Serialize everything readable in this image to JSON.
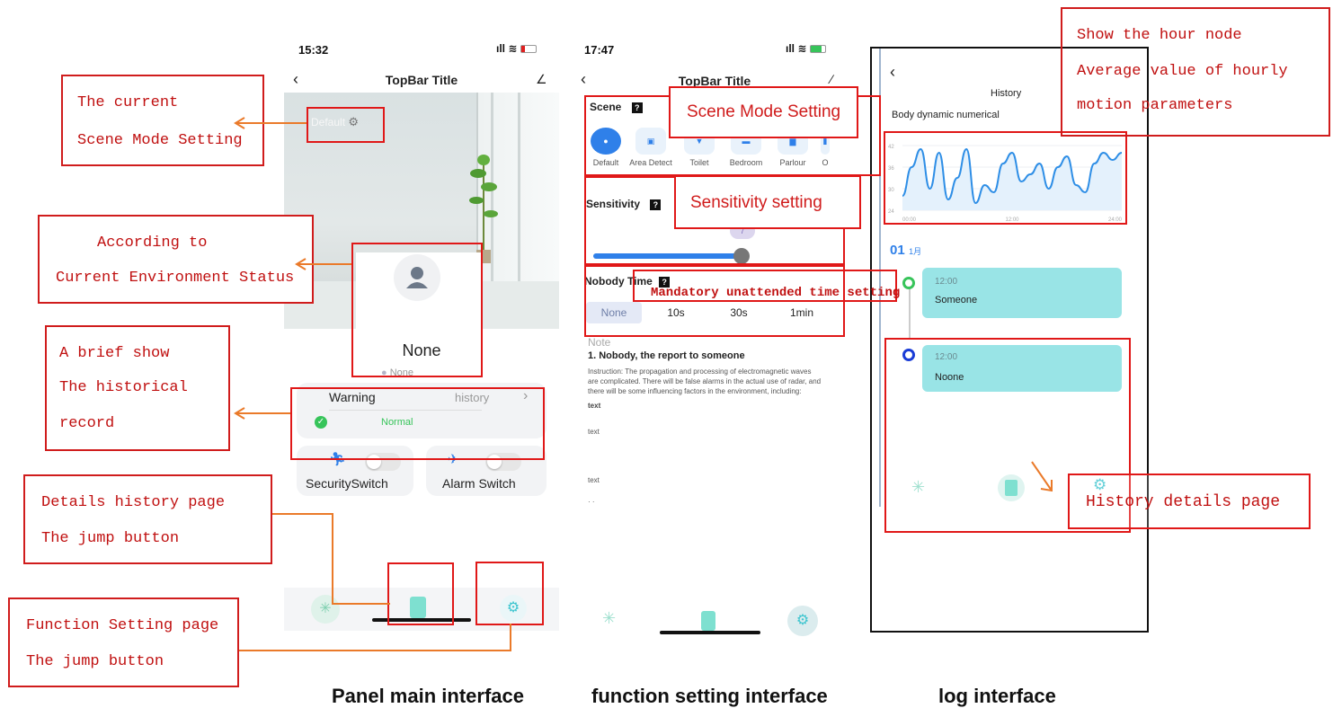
{
  "captions": {
    "panel_main": "Panel main interface",
    "function_setting": "function setting interface",
    "log": "log interface"
  },
  "phone1": {
    "status_time": "15:32",
    "topbar_title": "TopBar Title",
    "scene_label": "Default",
    "person_state": "None",
    "person_sub": "None",
    "warning_title": "Warning",
    "history_link": "history",
    "normal_status": "Normal",
    "security_switch": "SecuritySwitch",
    "alarm_switch": "Alarm Switch"
  },
  "phone2": {
    "status_time": "17:47",
    "topbar_title": "TopBar Title",
    "scene_heading": "Scene",
    "scenes": [
      "Default",
      "Area Detect",
      "Toilet",
      "Bedroom",
      "Parlour",
      "O"
    ],
    "sensitivity_heading": "Sensitivity",
    "sensitivity_value": "7",
    "nobody_heading": "Nobody Time",
    "nobody_options": [
      "None",
      "10s",
      "30s",
      "1min"
    ],
    "note_heading": "Note",
    "note_title": "1. Nobody, the report to someone",
    "note_body": "Instruction: The propagation and processing of electromagnetic waves are complicated. There will be false alarms in the actual use of radar, and there will be some influencing factors in the environment, including:",
    "note_text_overlap": "text",
    "text_items": [
      "text",
      "text",
      "· ·"
    ]
  },
  "phone3": {
    "history_title": "History",
    "chart_subtitle": "Body dynamic numerical",
    "date_day": "01",
    "date_month": "1月",
    "entries": [
      {
        "time": "12:00",
        "status": "Someone"
      },
      {
        "time": "12:00",
        "status": "Noone"
      }
    ]
  },
  "chart_data": {
    "type": "line",
    "title": "",
    "ylim": [
      24,
      42
    ],
    "yticks": [
      "42",
      "36",
      "30",
      "24"
    ],
    "xticks": [
      "00:00",
      "12:00",
      "24:00"
    ],
    "x": [
      0,
      1,
      2,
      3,
      4,
      5,
      6,
      7,
      8,
      9,
      10,
      11,
      12,
      13,
      14,
      15,
      16,
      17,
      18,
      19,
      20,
      21,
      22,
      23,
      24
    ],
    "series": [
      {
        "values": [
          28,
          36,
          41,
          30,
          40,
          27,
          33,
          41,
          26,
          31,
          29,
          37,
          40,
          32,
          34,
          37,
          30,
          36,
          39,
          31,
          29,
          37,
          40,
          38,
          40
        ]
      }
    ],
    "grid": true,
    "colors": {
      "line": "#2e8ee6",
      "fill": "#e4f1fc"
    }
  },
  "callouts": {
    "current_scene": [
      "The current",
      "Scene Mode Setting"
    ],
    "environment": [
      "According to",
      "Current Environment Status"
    ],
    "brief_history": [
      "A brief show",
      "The      historical",
      "record"
    ],
    "details_jump": [
      "Details history page",
      "The jump button"
    ],
    "function_jump": [
      "Function Setting page",
      "The jump button"
    ],
    "scene_mode": "Scene Mode Setting",
    "sensitivity": "Sensitivity setting",
    "unattended": "Mandatory unattended time setting",
    "hour_node": [
      "Show the hour node",
      "Average  value  of  hourly",
      "motion parameters"
    ],
    "history_details": "History details page"
  },
  "colors": {
    "accent_blue": "#2f80e9",
    "callout_red": "#e01818",
    "arrow_orange": "#ea7a2a",
    "teal_card": "#99e4e6",
    "normal_green": "#37c45a"
  }
}
